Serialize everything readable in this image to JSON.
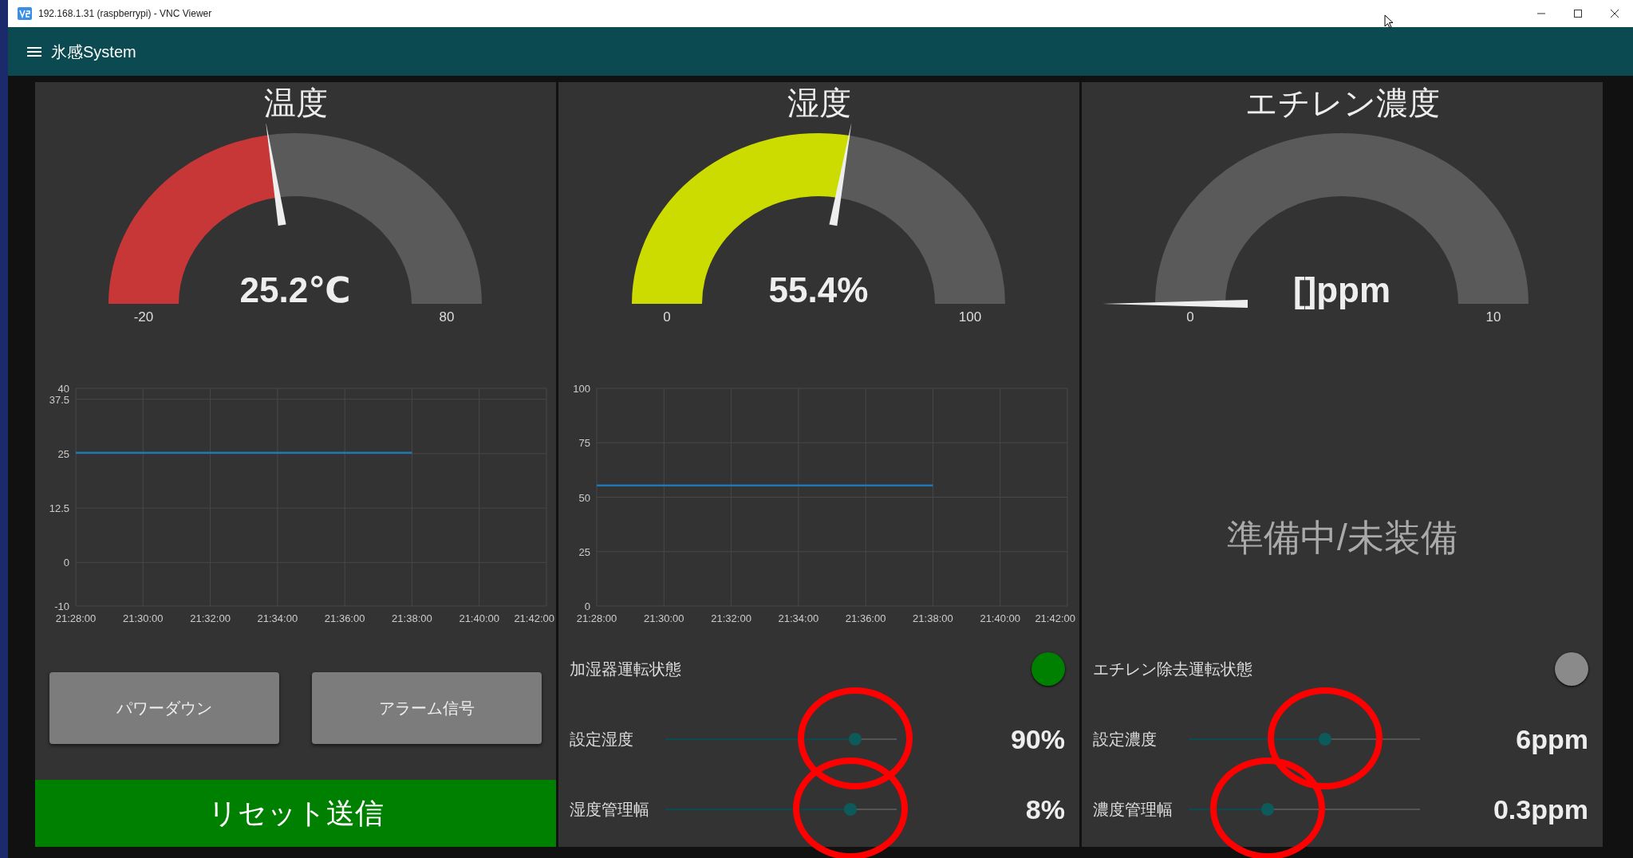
{
  "window": {
    "title": "192.168.1.31 (raspberrypi) - VNC Viewer"
  },
  "header": {
    "title": "氷感System"
  },
  "panels": [
    {
      "kind": "chart",
      "title": "温度",
      "gauge": {
        "value": "25.2℃",
        "min": "-20",
        "max": "80",
        "color": "#c83737"
      },
      "chart_data": {
        "type": "line",
        "categories": [
          "21:28:00",
          "21:30:00",
          "21:32:00",
          "21:34:00",
          "21:36:00",
          "21:38:00",
          "21:40:00",
          "21:42:00"
        ],
        "ylim": [
          -10,
          40
        ],
        "grid": true,
        "yticks": [
          -10,
          0,
          12.5,
          25,
          37.5,
          40
        ],
        "series": [
          {
            "color": "#1f77b4",
            "values": [
              25.2,
              25.2,
              25.2,
              25.2,
              25.2,
              25.2,
              null,
              null
            ]
          }
        ]
      },
      "buttons": [
        {
          "label": "パワーダウン"
        },
        {
          "label": "アラーム信号"
        }
      ],
      "action": {
        "label": "リセット送信"
      }
    },
    {
      "kind": "chart",
      "title": "湿度",
      "gauge": {
        "value": "55.4%",
        "min": "0",
        "max": "100",
        "color": "#cddc00"
      },
      "chart_data": {
        "type": "line",
        "categories": [
          "21:28:00",
          "21:30:00",
          "21:32:00",
          "21:34:00",
          "21:36:00",
          "21:38:00",
          "21:40:00",
          "21:42:00"
        ],
        "ylim": [
          0,
          100
        ],
        "grid": true,
        "yticks": [
          0,
          25,
          50,
          75,
          100
        ],
        "series": [
          {
            "color": "#1f77b4",
            "values": [
              55.4,
              55.4,
              55.4,
              55.4,
              55.4,
              55.4,
              null,
              null
            ]
          }
        ]
      },
      "status": {
        "label": "加湿器運転状態",
        "on": true
      },
      "sliders": [
        {
          "label": "設定湿度",
          "level": 0.82,
          "reading": "90%",
          "circled": true
        },
        {
          "label": "湿度管理幅",
          "level": 0.8,
          "reading": "8%",
          "circled": true
        }
      ]
    },
    {
      "kind": "notice",
      "title": "エチレン濃度",
      "gauge": {
        "value": "[]ppm",
        "min": "0",
        "max": "10"
      },
      "notice": "準備中/未装備",
      "status": {
        "label": "エチレン除去運転状態",
        "on": false
      },
      "sliders": [
        {
          "label": "設定濃度",
          "level": 0.59,
          "reading": "6ppm",
          "circled": true
        },
        {
          "label": "濃度管理幅",
          "level": 0.34,
          "reading": "0.3ppm",
          "circled": true
        }
      ]
    }
  ]
}
